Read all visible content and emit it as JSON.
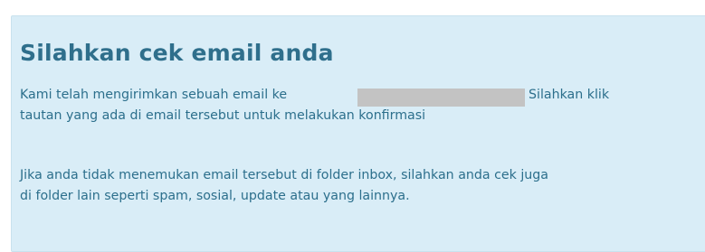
{
  "notice": {
    "title": "Silahkan cek email anda",
    "paragraph1": {
      "line1_before": "Kami telah mengirimkan sebuah email ke",
      "line1_after": "Silahkan klik",
      "line2": "tautan yang ada di email tersebut untuk melakukan konfirmasi"
    },
    "paragraph2": {
      "line1": "Jika anda tidak menemukan email tersebut di folder inbox, silahkan anda cek juga",
      "line2": "di folder lain seperti spam, sosial, update atau yang lainnya."
    }
  },
  "colors": {
    "background": "#d9edf7",
    "text": "#2c6f8c",
    "redaction": "#c3c3c3"
  }
}
